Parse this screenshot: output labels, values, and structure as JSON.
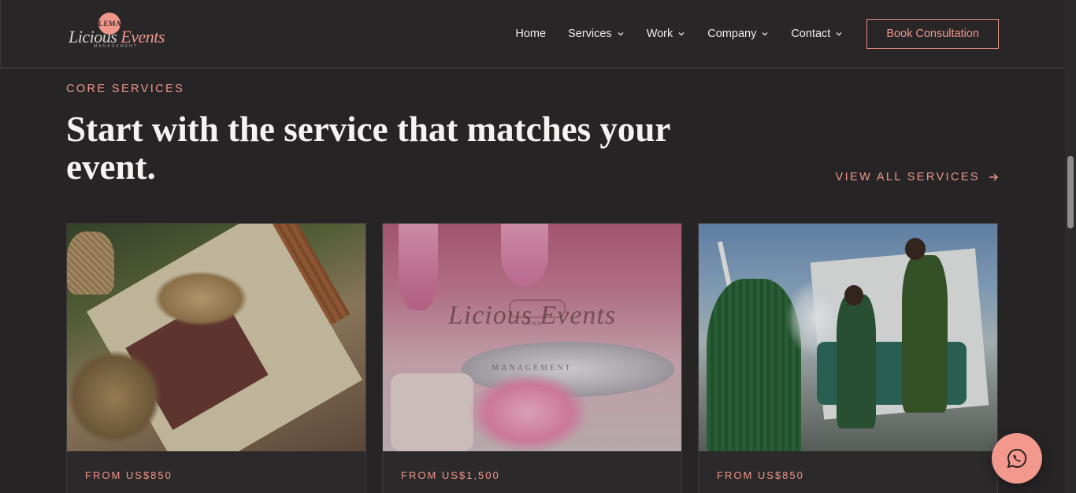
{
  "brand": {
    "badge": "LEMA",
    "script_part1": "Licious",
    "script_part2": "Events",
    "sub": "MANAGEMENT"
  },
  "nav": {
    "items": [
      {
        "label": "Home",
        "dropdown": false
      },
      {
        "label": "Services",
        "dropdown": true
      },
      {
        "label": "Work",
        "dropdown": true
      },
      {
        "label": "Company",
        "dropdown": true
      },
      {
        "label": "Contact",
        "dropdown": true
      }
    ],
    "cta": "Book Consultation"
  },
  "section": {
    "eyebrow": "CORE SERVICES",
    "headline": "Start with the service that matches your event.",
    "view_all": "VIEW ALL SERVICES",
    "view_all_icon": "arrow-right-icon"
  },
  "cards": [
    {
      "price": "FROM US$850"
    },
    {
      "price": "FROM US$1,500",
      "watermark": "Licious  Events",
      "watermark_sub": "MANAGEMENT",
      "watermark_badge": "LEMA"
    },
    {
      "price": "FROM US$850"
    }
  ],
  "floating": {
    "icon": "whatsapp-icon"
  },
  "colors": {
    "accent": "#f0978c",
    "background": "#262425",
    "text": "#f6f3f3"
  }
}
